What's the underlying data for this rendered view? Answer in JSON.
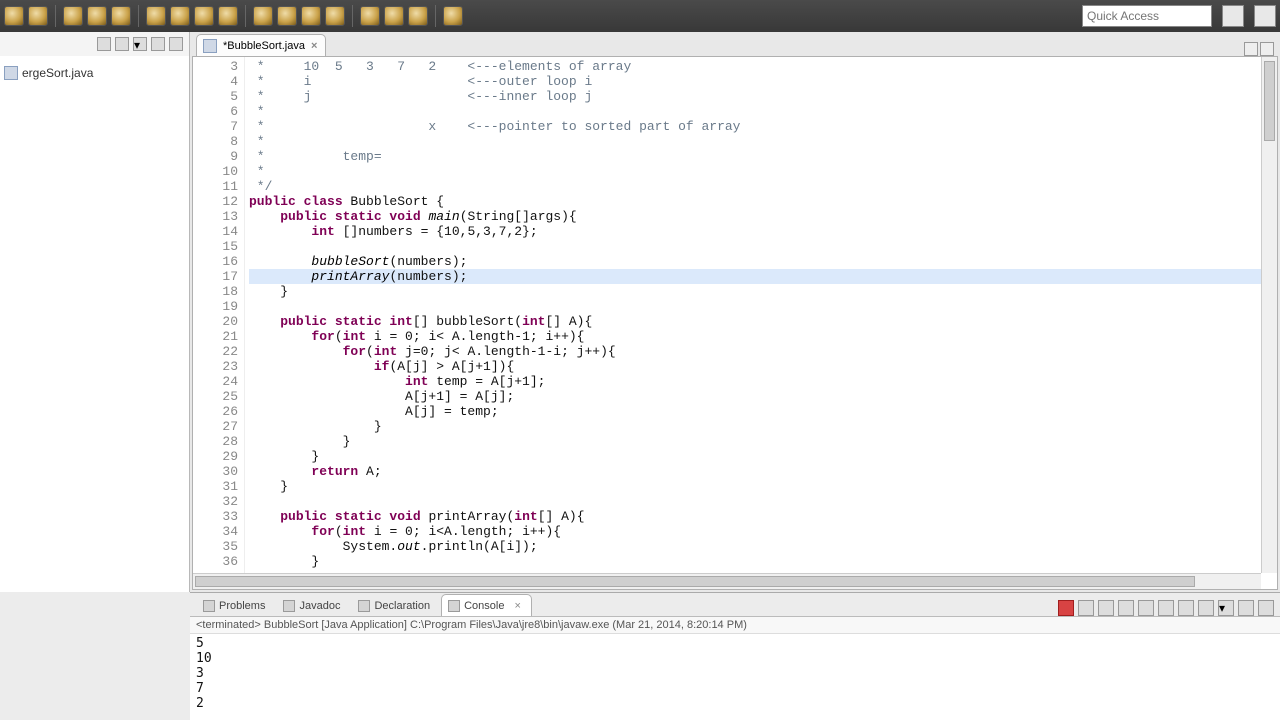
{
  "quick_access_placeholder": "Quick Access",
  "explorer": {
    "file": "ergeSort.java"
  },
  "editor_tab": {
    "title": "*BubbleSort.java"
  },
  "code_first_line_no": 3,
  "code_lines": [
    {
      "raw": " *     10  5   3   7   2    <---elements of array",
      "cls": "cm"
    },
    {
      "raw": " *     i                    <---outer loop i",
      "cls": "cm"
    },
    {
      "raw": " *     j                    <---inner loop j",
      "cls": "cm"
    },
    {
      "raw": " *",
      "cls": "cm"
    },
    {
      "raw": " *                     x    <---pointer to sorted part of array",
      "cls": "cm"
    },
    {
      "raw": " *",
      "cls": "cm"
    },
    {
      "raw": " *          temp=",
      "cls": "cm"
    },
    {
      "raw": " *",
      "cls": "cm"
    },
    {
      "raw": " */",
      "cls": "cm"
    },
    {
      "html": "<span class='kw'>public class</span> BubbleSort {"
    },
    {
      "html": "    <span class='kw'>public static void</span> <span class='it'>main</span>(String[]args){"
    },
    {
      "html": "        <span class='kw'>int</span> []numbers = {10,5,3,7,2};"
    },
    {
      "raw": ""
    },
    {
      "html": "        <span class='it'>bubbleSort</span>(numbers);"
    },
    {
      "html": "        <span class='it'>printArray</span>(numbers);",
      "highlight": true
    },
    {
      "raw": "    }"
    },
    {
      "raw": ""
    },
    {
      "html": "    <span class='kw'>public static int</span>[] bubbleSort(<span class='kw'>int</span>[] A){"
    },
    {
      "html": "        <span class='kw'>for</span>(<span class='kw'>int</span> i = 0; i&lt; A.length-1; i++){"
    },
    {
      "html": "            <span class='kw'>for</span>(<span class='kw'>int</span> j=0; j&lt; A.length-1-i; j++){"
    },
    {
      "html": "                <span class='kw'>if</span>(A[j] &gt; A[j+1]){"
    },
    {
      "html": "                    <span class='kw'>int</span> temp = A[j+1];"
    },
    {
      "raw": "                    A[j+1] = A[j];"
    },
    {
      "raw": "                    A[j] = temp;"
    },
    {
      "raw": "                }"
    },
    {
      "raw": "            }"
    },
    {
      "raw": "        }"
    },
    {
      "html": "        <span class='kw'>return</span> A;"
    },
    {
      "raw": "    }"
    },
    {
      "raw": ""
    },
    {
      "html": "    <span class='kw'>public static void</span> printArray(<span class='kw'>int</span>[] A){"
    },
    {
      "html": "        <span class='kw'>for</span>(<span class='kw'>int</span> i = 0; i&lt;A.length; i++){"
    },
    {
      "html": "            System.<span class='it'>out</span>.println(A[i]);"
    },
    {
      "raw": "        }"
    }
  ],
  "bottom_views": {
    "tabs": [
      "Problems",
      "Javadoc",
      "Declaration",
      "Console"
    ],
    "active": 3,
    "console_header": "<terminated> BubbleSort [Java Application] C:\\Program Files\\Java\\jre8\\bin\\javaw.exe (Mar 21, 2014, 8:20:14 PM)",
    "console_lines": [
      "5",
      "10",
      "3",
      "7",
      "2"
    ]
  }
}
